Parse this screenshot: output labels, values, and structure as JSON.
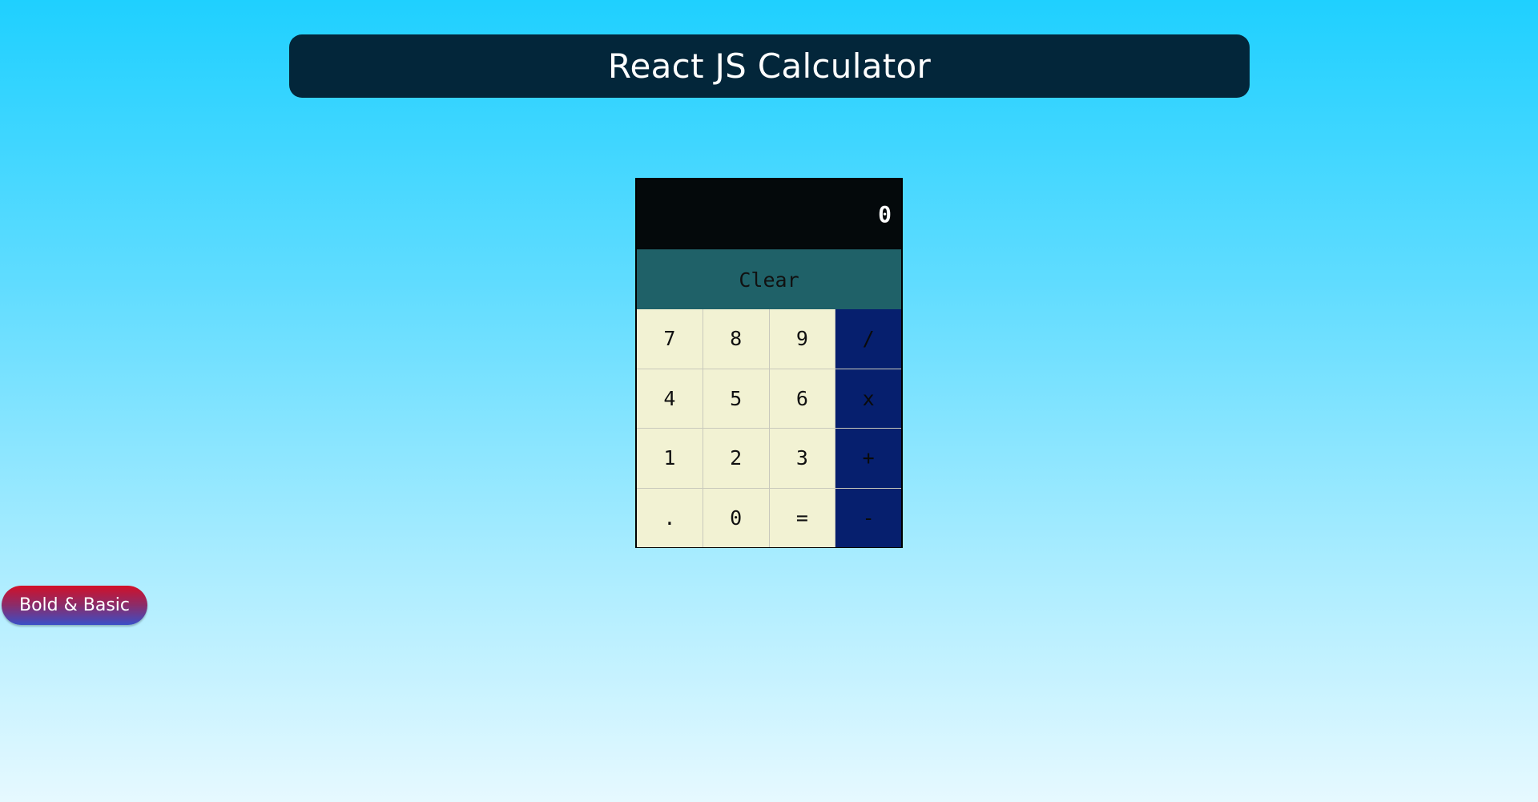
{
  "header": {
    "title": "React JS Calculator"
  },
  "calculator": {
    "display_value": "0",
    "clear_label": "Clear",
    "keys": [
      {
        "label": "7",
        "type": "digit"
      },
      {
        "label": "8",
        "type": "digit"
      },
      {
        "label": "9",
        "type": "digit"
      },
      {
        "label": "/",
        "type": "operator"
      },
      {
        "label": "4",
        "type": "digit"
      },
      {
        "label": "5",
        "type": "digit"
      },
      {
        "label": "6",
        "type": "digit"
      },
      {
        "label": "x",
        "type": "operator"
      },
      {
        "label": "1",
        "type": "digit"
      },
      {
        "label": "2",
        "type": "digit"
      },
      {
        "label": "3",
        "type": "digit"
      },
      {
        "label": "+",
        "type": "operator"
      },
      {
        "label": ".",
        "type": "digit"
      },
      {
        "label": "0",
        "type": "digit"
      },
      {
        "label": "=",
        "type": "digit"
      },
      {
        "label": "-",
        "type": "operator"
      }
    ]
  },
  "theme_button": {
    "label": "Bold & Basic"
  },
  "colors": {
    "header_bg": "#03263a",
    "display_bg": "#04090b",
    "clear_bg": "#1f6168",
    "digit_key_bg": "#f2f2d3",
    "operator_key_bg": "#061f6e"
  }
}
